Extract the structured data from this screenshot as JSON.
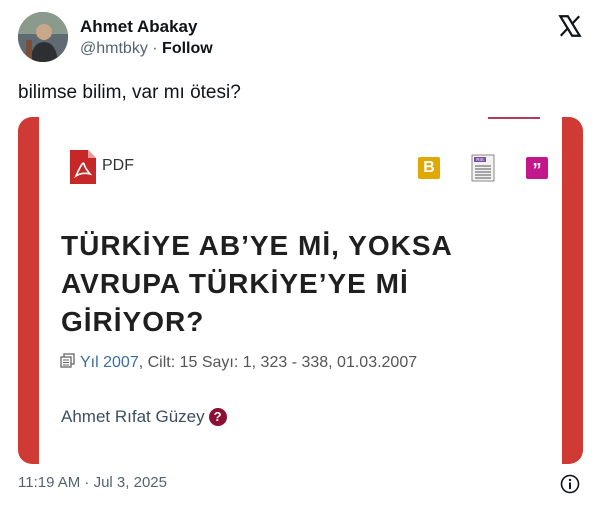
{
  "author": {
    "name": "Ahmet Abakay",
    "handle": "@hmtbky",
    "separator": "·",
    "follow": "Follow"
  },
  "tweet": {
    "text": "bilimse bilim, var mı ötesi?",
    "timestamp": "11:19 AM · Jul 3, 2025"
  },
  "card": {
    "pdf_label": "PDF",
    "b_label": "B",
    "ris_label": "RIS",
    "quote_label": "”",
    "title": "TÜRKİYE AB’YE Mİ, YOKSA AVRUPA TÜRKİYE’YE Mİ GİRİYOR?",
    "year_link": "Yıl 2007",
    "meta_rest": ", Cilt: 15 Sayı: 1, 323 - 338, 01.03.2007",
    "author": "Ahmet Rıfat Güzey",
    "author_badge": "?"
  },
  "colors": {
    "band": "#d03a35",
    "link": "#3a6ea5",
    "b_icon": "#e0a800",
    "quote_icon": "#c2188b",
    "author_badge": "#8b1034"
  },
  "icons": [
    "x-logo-icon",
    "pdf-icon",
    "copy-icon",
    "info-icon",
    "question-icon"
  ]
}
